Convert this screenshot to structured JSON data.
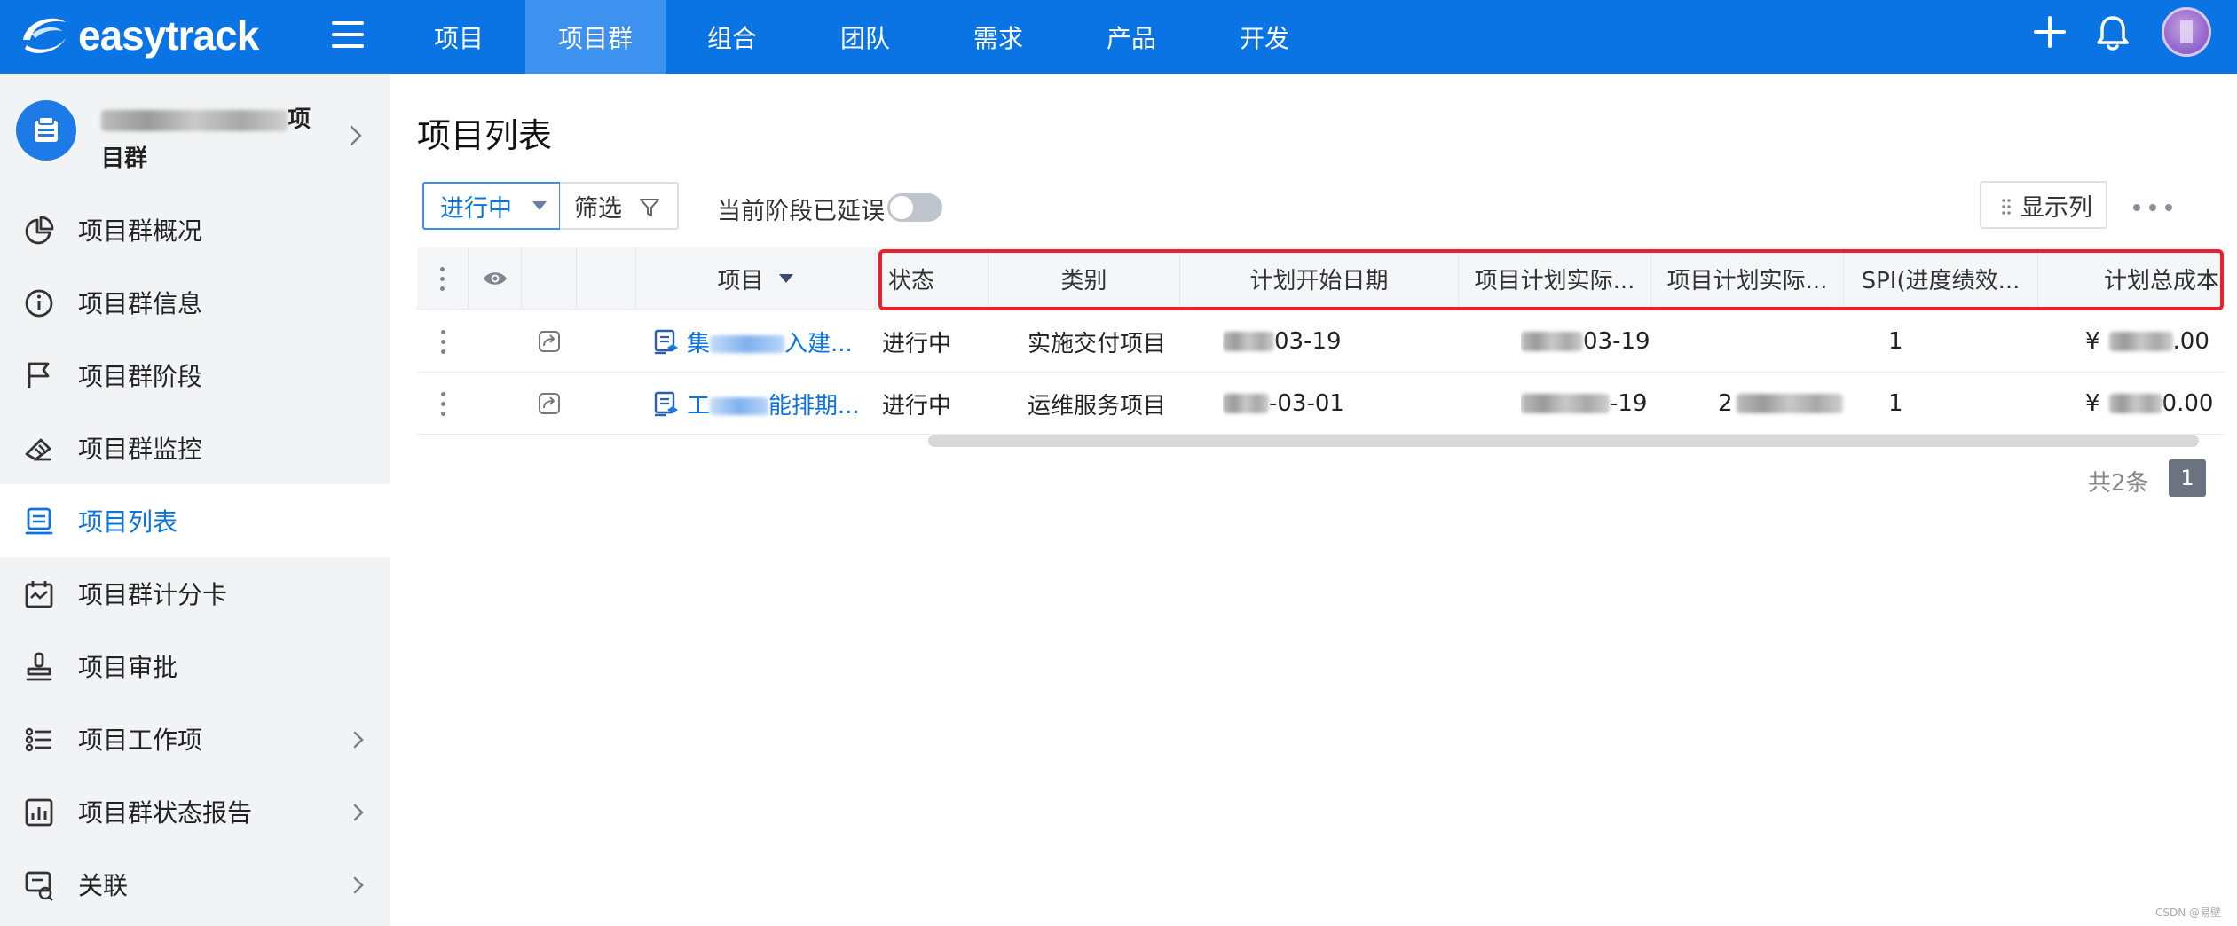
{
  "app": {
    "brand": "easytrack",
    "nav": [
      {
        "label": "项目",
        "active": false
      },
      {
        "label": "项目群",
        "active": true
      },
      {
        "label": "组合",
        "active": false
      },
      {
        "label": "团队",
        "active": false
      },
      {
        "label": "需求",
        "active": false
      },
      {
        "label": "产品",
        "active": false
      },
      {
        "label": "开发",
        "active": false
      }
    ],
    "accent_color": "#0b74e5"
  },
  "sidebar": {
    "group_name_suffix": "项",
    "group_name_line2": "目群",
    "items": [
      {
        "label": "项目群概况",
        "icon": "pie-chart-icon"
      },
      {
        "label": "项目群信息",
        "icon": "info-icon"
      },
      {
        "label": "项目群阶段",
        "icon": "flag-icon"
      },
      {
        "label": "项目群监控",
        "icon": "monitor-icon"
      },
      {
        "label": "项目列表",
        "icon": "project-list-icon",
        "active": true
      },
      {
        "label": "项目群计分卡",
        "icon": "scorecard-icon"
      },
      {
        "label": "项目审批",
        "icon": "stamp-icon"
      },
      {
        "label": "项目工作项",
        "icon": "list-icon",
        "has_children": true
      },
      {
        "label": "项目群状态报告",
        "icon": "report-chart-icon",
        "has_children": true
      },
      {
        "label": "关联",
        "icon": "link-icon",
        "has_children": true
      }
    ]
  },
  "main": {
    "title": "项目列表",
    "status_filter": "进行中",
    "filter_label": "筛选",
    "delay_label": "当前阶段已延误",
    "delay_toggle_on": false,
    "columns_label": "显示列",
    "table": {
      "headers": {
        "project": "项目",
        "status": "状态",
        "category": "类别",
        "plan_start": "计划开始日期",
        "actual_1": "项目计划实际...",
        "actual_2": "项目计划实际...",
        "spi": "SPI(进度绩效...",
        "total_cost": "计划总成本"
      },
      "rows": [
        {
          "project_prefix": "集",
          "project_suffix": "入建...",
          "status": "进行中",
          "category": "实施交付项目",
          "plan_start_visible": "03-19",
          "actual_1_visible": "03-19",
          "actual_2_visible": "",
          "spi": "1",
          "cost_prefix": "¥",
          "cost_suffix": ".00"
        },
        {
          "project_prefix": "工",
          "project_suffix": "能排期...",
          "status": "进行中",
          "category": "运维服务项目",
          "plan_start_visible": "-03-01",
          "actual_1_visible": "-19",
          "actual_2_visible": "2",
          "spi": "1",
          "cost_prefix": "¥",
          "cost_suffix": "0.00"
        }
      ]
    },
    "pagination": {
      "total_text": "共2条",
      "current_page": "1"
    }
  },
  "watermark": "CSDN @易壁"
}
